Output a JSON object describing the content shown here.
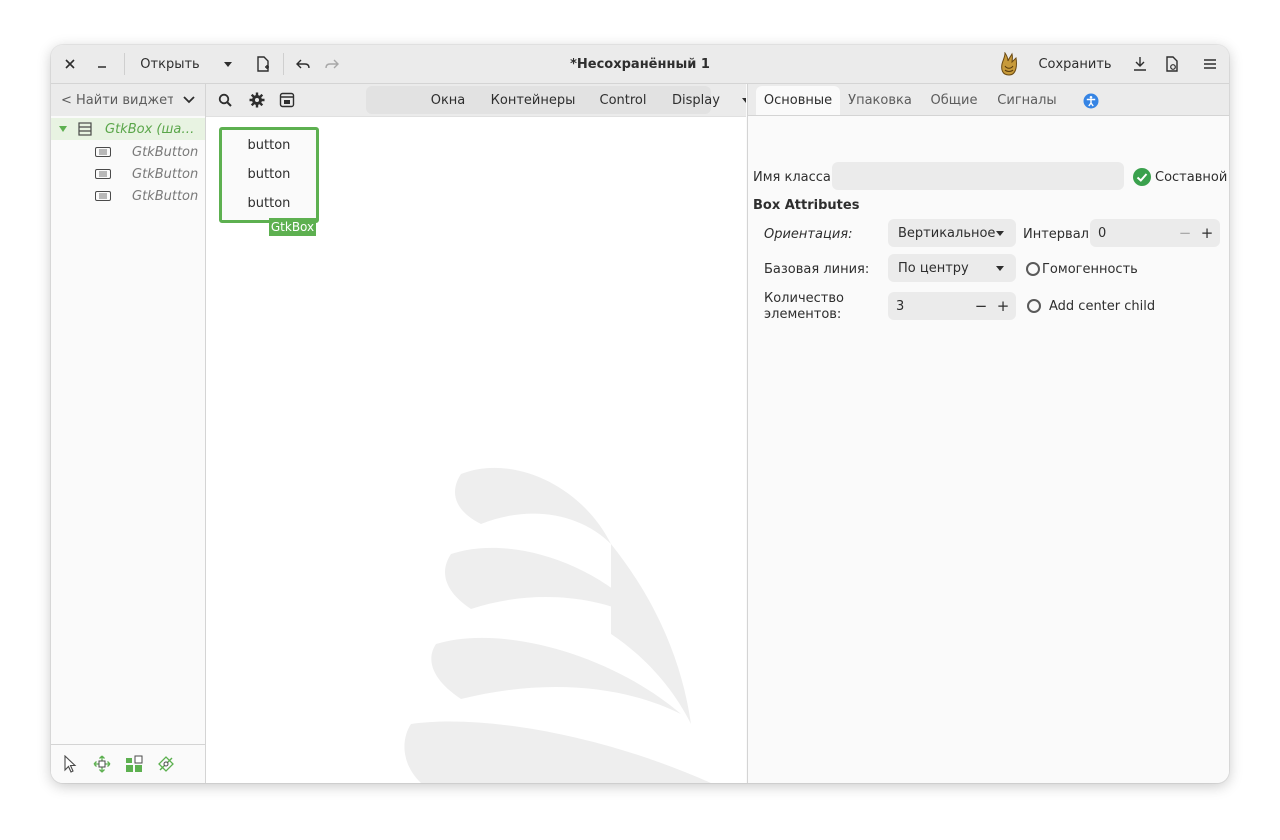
{
  "window": {
    "title": "*Несохранённый 1",
    "open_label": "Открыть",
    "save_label": "Сохранить"
  },
  "left_panel": {
    "search_label": "< Найти виджет…",
    "tree": [
      {
        "label": "GtkBox (ша…",
        "selected": true
      },
      {
        "label": "GtkButton"
      },
      {
        "label": "GtkButton"
      },
      {
        "label": "GtkButton"
      }
    ],
    "tool_icons": [
      "pointer-icon",
      "drag-resize-icon",
      "margin-icon",
      "align-icon"
    ]
  },
  "center_panel": {
    "palette_tabs": [
      "Окна",
      "Контейнеры",
      "Control",
      "Display"
    ],
    "canvas": {
      "buttons": [
        "button",
        "button",
        "button"
      ],
      "box_tag": "GtkBox"
    }
  },
  "right_panel": {
    "tabs": [
      "Основные",
      "Упаковка",
      "Общие",
      "Сигналы"
    ],
    "class_name_label": "Имя класса:",
    "composite_label": "Составной",
    "section_title": "Box Attributes",
    "orientation_label": "Ориентация:",
    "orientation_value": "Вертикальное",
    "spacing_label": "Интервал:",
    "spacing_value": "0",
    "baseline_label": "Базовая линия:",
    "baseline_value": "По центру",
    "homogeneous_label": "Гомогенность",
    "count_label_line1": "Количество",
    "count_label_line2": "элементов:",
    "count_value": "3",
    "center_child_label": "Add center child",
    "minus": "−",
    "plus": "+"
  },
  "colors": {
    "accent_green": "#5db050",
    "selection_bg": "#e8f3e2",
    "header_bg": "#ebebeb"
  }
}
